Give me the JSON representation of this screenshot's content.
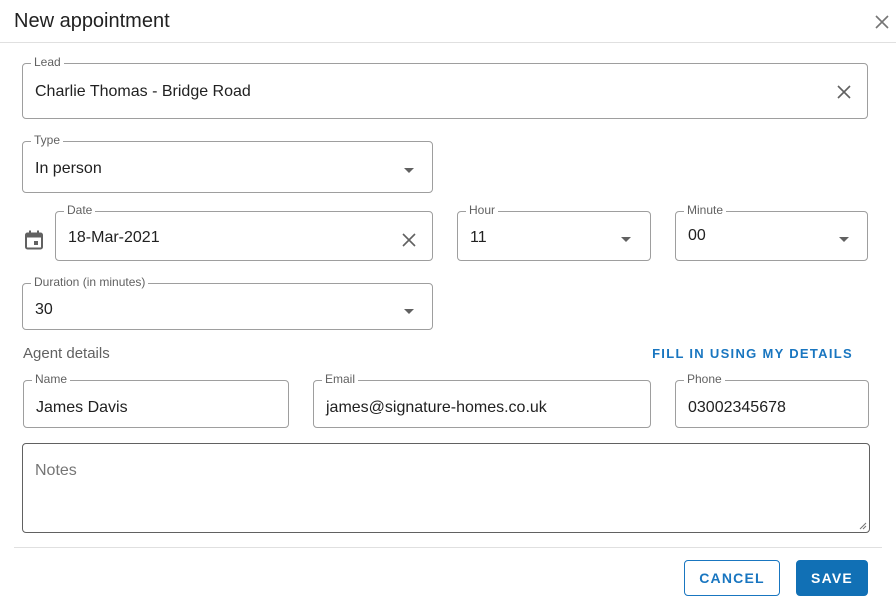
{
  "dialog": {
    "title": "New appointment"
  },
  "lead": {
    "label": "Lead",
    "value": "Charlie Thomas - Bridge Road"
  },
  "type": {
    "label": "Type",
    "value": "In person"
  },
  "date": {
    "label": "Date",
    "value": "18-Mar-2021"
  },
  "hour": {
    "label": "Hour",
    "value": "11"
  },
  "minute": {
    "label": "Minute",
    "value": "00"
  },
  "duration": {
    "label": "Duration (in minutes)",
    "value": "30"
  },
  "agent": {
    "section_label": "Agent details",
    "fill_link": "FILL IN USING MY DETAILS",
    "name": {
      "label": "Name",
      "value": "James Davis"
    },
    "email": {
      "label": "Email",
      "value": "james@signature-homes.co.uk"
    },
    "phone": {
      "label": "Phone",
      "value": "03002345678"
    }
  },
  "notes": {
    "placeholder": "Notes"
  },
  "actions": {
    "cancel": "CANCEL",
    "save": "SAVE"
  },
  "colors": {
    "accent": "#1976c0",
    "save_bg": "#1170b5"
  },
  "icons": {
    "close": "close-icon",
    "clear": "clear-icon",
    "dropdown": "arrow-drop-down-icon",
    "calendar": "calendar-icon"
  }
}
